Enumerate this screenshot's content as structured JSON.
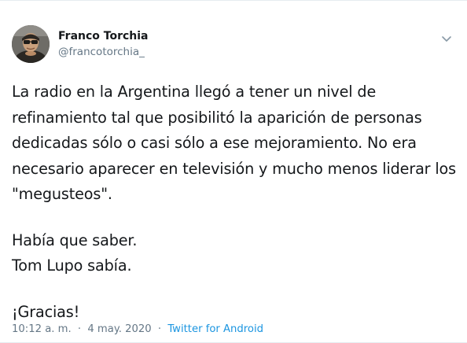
{
  "tweet": {
    "author": {
      "name": "Franco Torchia",
      "handle": "@francotorchia_"
    },
    "paragraphs": [
      "La radio en la Argentina llegó a tener un nivel de refinamiento tal que posibilitó la aparición de personas dedicadas sólo o casi sólo a ese mejoramiento. No era necesario aparecer en televisión y mucho menos liderar los \"megusteos\".",
      "Había que saber.",
      "Tom Lupo sabía.",
      "¡Gracias!"
    ],
    "time": "10:12 a. m.",
    "separator": "·",
    "date": "4 may. 2020",
    "source": "Twitter for Android"
  },
  "colors": {
    "text": "#14171a",
    "secondary": "#657786",
    "link": "#1b95e0",
    "divider": "#e6ecf0"
  },
  "icons": {
    "caret": "chevron-down-icon",
    "avatar": "profile-photo"
  }
}
